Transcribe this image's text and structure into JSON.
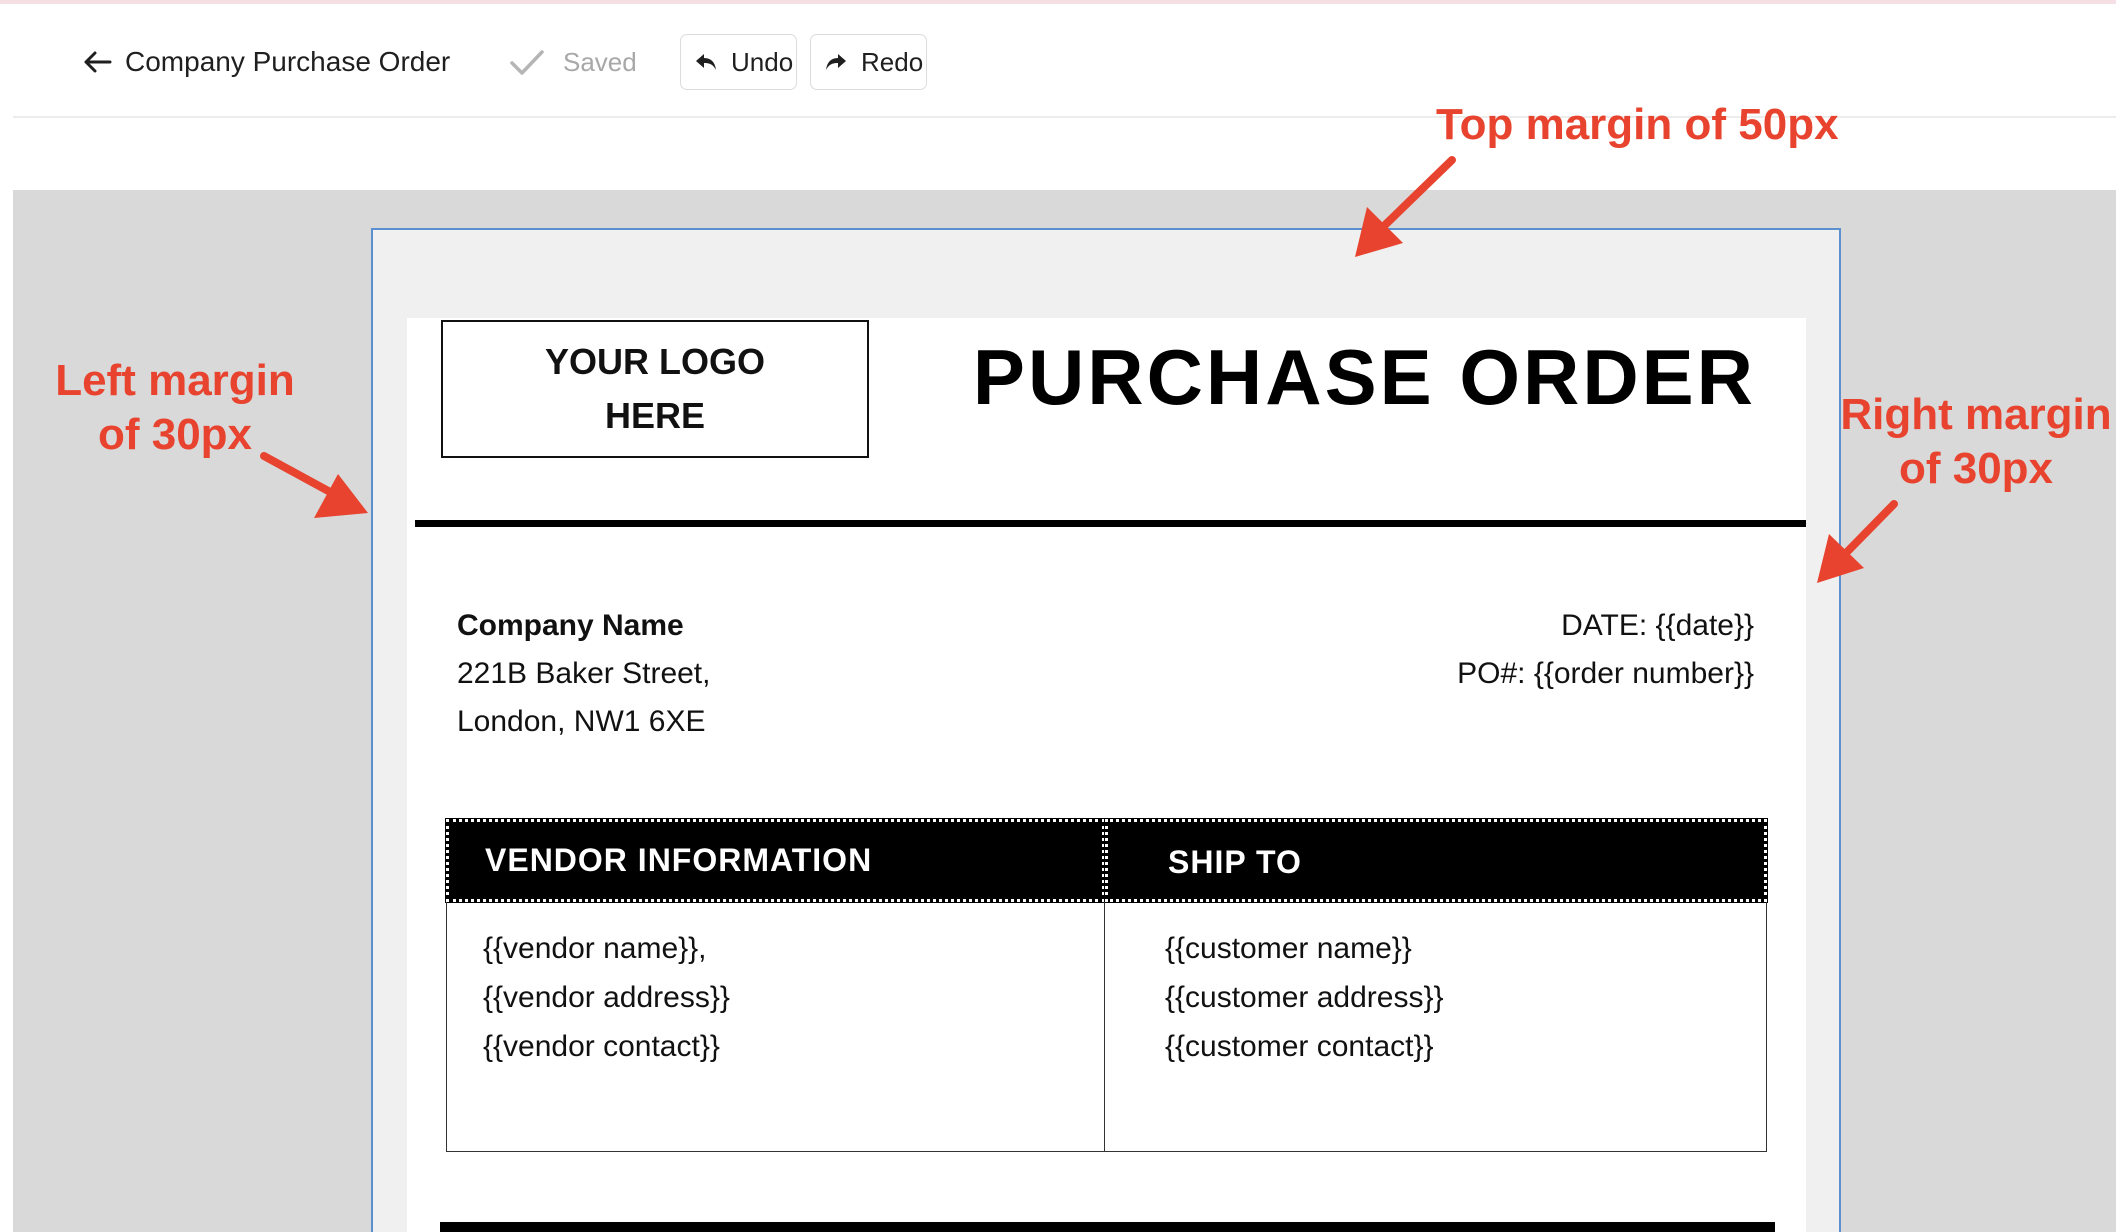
{
  "toolbar": {
    "title": "Company Purchase Order",
    "saved_label": "Saved",
    "undo_label": "Undo",
    "redo_label": "Redo"
  },
  "document": {
    "logo_text": "YOUR LOGO\nHERE",
    "title": "PURCHASE ORDER",
    "company": {
      "name": "Company Name",
      "address_line1": "221B Baker Street,",
      "address_line2": "London, NW1 6XE"
    },
    "date_line": "DATE: {{date}}",
    "po_line": "PO#: {{order number}}",
    "vendor": {
      "heading": "VENDOR INFORMATION",
      "lines": [
        "{{vendor name}},",
        "{{vendor address}}",
        "{{vendor contact}}"
      ]
    },
    "ship_to": {
      "heading": "SHIP TO",
      "lines": [
        "{{customer name}}",
        "{{customer address}}",
        "{{customer contact}}"
      ]
    }
  },
  "annotations": {
    "top": "Top margin of 50px",
    "left": "Left margin\nof 30px",
    "right": "Right margin\nof 30px"
  },
  "colors": {
    "annotation": "#e8432e",
    "selection_border": "#5a8fd0",
    "canvas": "#d9d9d9"
  },
  "icons": {
    "back": "arrow-left-icon",
    "saved": "check-icon",
    "undo": "undo-arrow-icon",
    "redo": "redo-arrow-icon"
  }
}
